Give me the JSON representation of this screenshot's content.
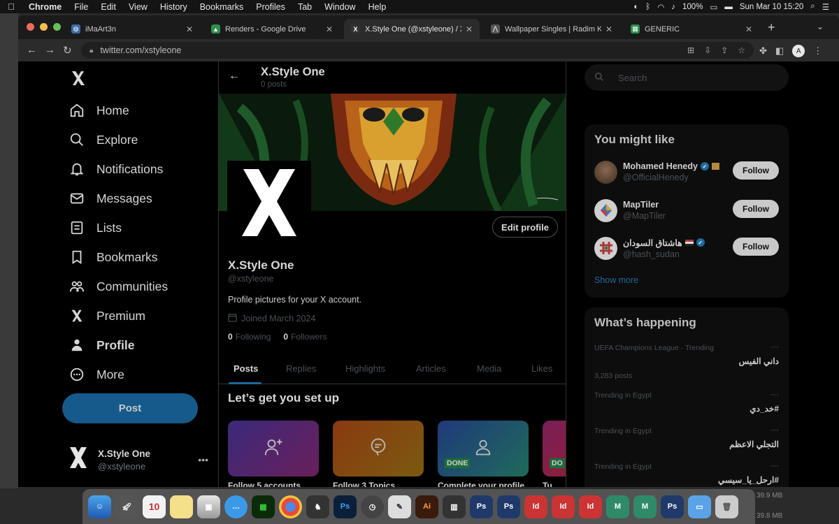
{
  "menubar": {
    "app": "Chrome",
    "items": [
      "File",
      "Edit",
      "View",
      "History",
      "Bookmarks",
      "Profiles",
      "Tab",
      "Window",
      "Help"
    ],
    "battery": "100%",
    "datetime": "Sun Mar 10  15:20"
  },
  "browser": {
    "tabs": [
      {
        "title": "iMaArt3n",
        "color": "#3a6ea5",
        "glyph": "◍"
      },
      {
        "title": "Renders - Google Drive",
        "color": "#2f8f4e",
        "glyph": "▲"
      },
      {
        "title": "X.Style One (@xstyleone) / X",
        "color": "#333333",
        "glyph": "𝕏"
      },
      {
        "title": "Wallpaper Singles | Radim Kac",
        "color": "#555555",
        "glyph": "⋀"
      },
      {
        "title": "GENERIC",
        "color": "#2f8f4e",
        "glyph": "▦"
      }
    ],
    "url": "twitter.com/xstyleone",
    "profile_initial": "A"
  },
  "nav": {
    "items": [
      {
        "label": "Home",
        "icon": "home-icon"
      },
      {
        "label": "Explore",
        "icon": "search-icon"
      },
      {
        "label": "Notifications",
        "icon": "bell-icon"
      },
      {
        "label": "Messages",
        "icon": "mail-icon"
      },
      {
        "label": "Lists",
        "icon": "list-icon"
      },
      {
        "label": "Bookmarks",
        "icon": "bookmark-icon"
      },
      {
        "label": "Communities",
        "icon": "communities-icon"
      },
      {
        "label": "Premium",
        "icon": "x-logo-icon"
      },
      {
        "label": "Profile",
        "icon": "person-icon"
      },
      {
        "label": "More",
        "icon": "more-circle-icon"
      }
    ],
    "post_label": "Post",
    "account_name": "X.Style One",
    "account_handle": "@xstyleone"
  },
  "profile": {
    "header_title": "X.Style One",
    "header_sub": "0 posts",
    "edit_label": "Edit profile",
    "name": "X.Style One",
    "handle": "@xstyleone",
    "bio": "Profile pictures for your X account.",
    "joined": "Joined March 2024",
    "following_count": "0",
    "following_label": "Following",
    "followers_count": "0",
    "followers_label": "Followers",
    "tabs": [
      "Posts",
      "Replies",
      "Highlights",
      "Articles",
      "Media",
      "Likes"
    ],
    "setup_title": "Let’s get you set up",
    "cards": [
      {
        "label": "Follow 5 accounts",
        "done": ""
      },
      {
        "label": "Follow 3 Topics",
        "done": ""
      },
      {
        "label": "Complete your profile",
        "done": "DONE"
      },
      {
        "label": "Tu",
        "done": "DO"
      }
    ]
  },
  "sidebar": {
    "search_placeholder": "Search",
    "might_like_title": "You might like",
    "suggestions": [
      {
        "name": "Mohamed Henedy",
        "handle": "@OfficialHenedy",
        "follow": "Follow"
      },
      {
        "name": "MapTiler",
        "handle": "@MapTiler",
        "follow": "Follow"
      },
      {
        "name": "هاشتاق السودان",
        "handle": "@hash_sudan",
        "follow": "Follow"
      }
    ],
    "show_more": "Show more",
    "happening_title": "What’s happening",
    "trends": [
      {
        "context": "UEFA Champions League · Trending",
        "title": "داني الفيس",
        "posts": "3,283 posts"
      },
      {
        "context": "Trending in Egypt",
        "title": "#خد_دي",
        "posts": ""
      },
      {
        "context": "Trending in Egypt",
        "title": "التجلي الاعظم",
        "posts": ""
      },
      {
        "context": "Trending in Egypt",
        "title": "#ارحل_يا_سيسي",
        "posts": ""
      }
    ]
  },
  "dock": {
    "calendar_day": "10",
    "size_1": "39.9 MB",
    "size_2": "39.8 MB"
  }
}
